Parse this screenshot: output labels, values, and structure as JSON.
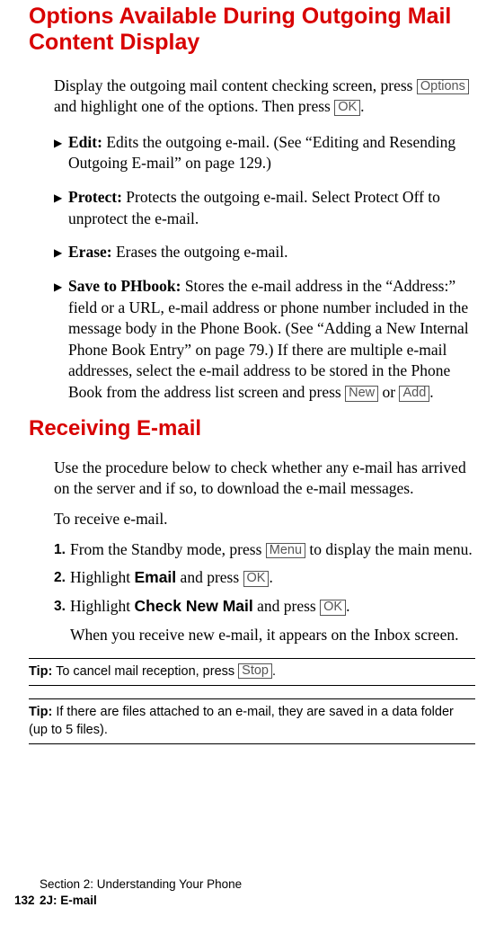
{
  "heading1": "Options Available During Outgoing Mail Content Display",
  "intro": {
    "t1": "Display the outgoing mail content checking screen, press ",
    "k1": "Options",
    "t2": " and highlight one of the options. Then press ",
    "k2": "OK",
    "t3": "."
  },
  "bullets": [
    {
      "label": "Edit:",
      "text": " Edits the outgoing e-mail. (See “Editing and Resending Outgoing E-mail” on page 129.)"
    },
    {
      "label": "Protect:",
      "text": " Protects the outgoing e-mail. Select Protect Off to unprotect the e-mail."
    },
    {
      "label": "Erase:",
      "text": " Erases the outgoing e-mail."
    },
    {
      "label": "Save to PHbook:",
      "t1": " Stores the e-mail address in the “Address:” field or a URL, e-mail address or phone number included in the message body in the Phone Book. (See “Adding a New Internal Phone Book Entry” on page 79.) If there are multiple e-mail addresses, select the e-mail address to be stored in the Phone Book from the address list screen and press ",
      "k1": "New",
      "t2": " or ",
      "k2": "Add",
      "t3": "."
    }
  ],
  "heading2": "Receiving E-mail",
  "recv_intro": "Use the procedure below to check whether any e-mail has arrived on the server and if so, to download the e-mail messages.",
  "recv_lead": "To receive e-mail.",
  "steps": [
    {
      "n": "1.",
      "t1": "From the Standby mode, press ",
      "k1": "Menu",
      "t2": " to display the main menu."
    },
    {
      "n": "2.",
      "t1": "Highlight ",
      "b1": "Email",
      "t2": " and press ",
      "k1": "OK",
      "t3": "."
    },
    {
      "n": "3.",
      "t1": "Highlight ",
      "b1": "Check New Mail",
      "t2": " and press ",
      "k1": "OK",
      "t3": "."
    }
  ],
  "step_result": "When you receive new e-mail, it appears on the Inbox screen.",
  "tip1": {
    "label": "Tip:",
    "t1": " To cancel mail reception, press ",
    "k1": "Stop",
    "t2": "."
  },
  "tip2": {
    "label": "Tip:",
    "t1": " If there are files attached to an e-mail, they are saved in a data folder (up to 5 files)."
  },
  "footer": {
    "line1": "Section 2: Understanding Your Phone",
    "page": "132",
    "line2": "2J: E-mail"
  }
}
